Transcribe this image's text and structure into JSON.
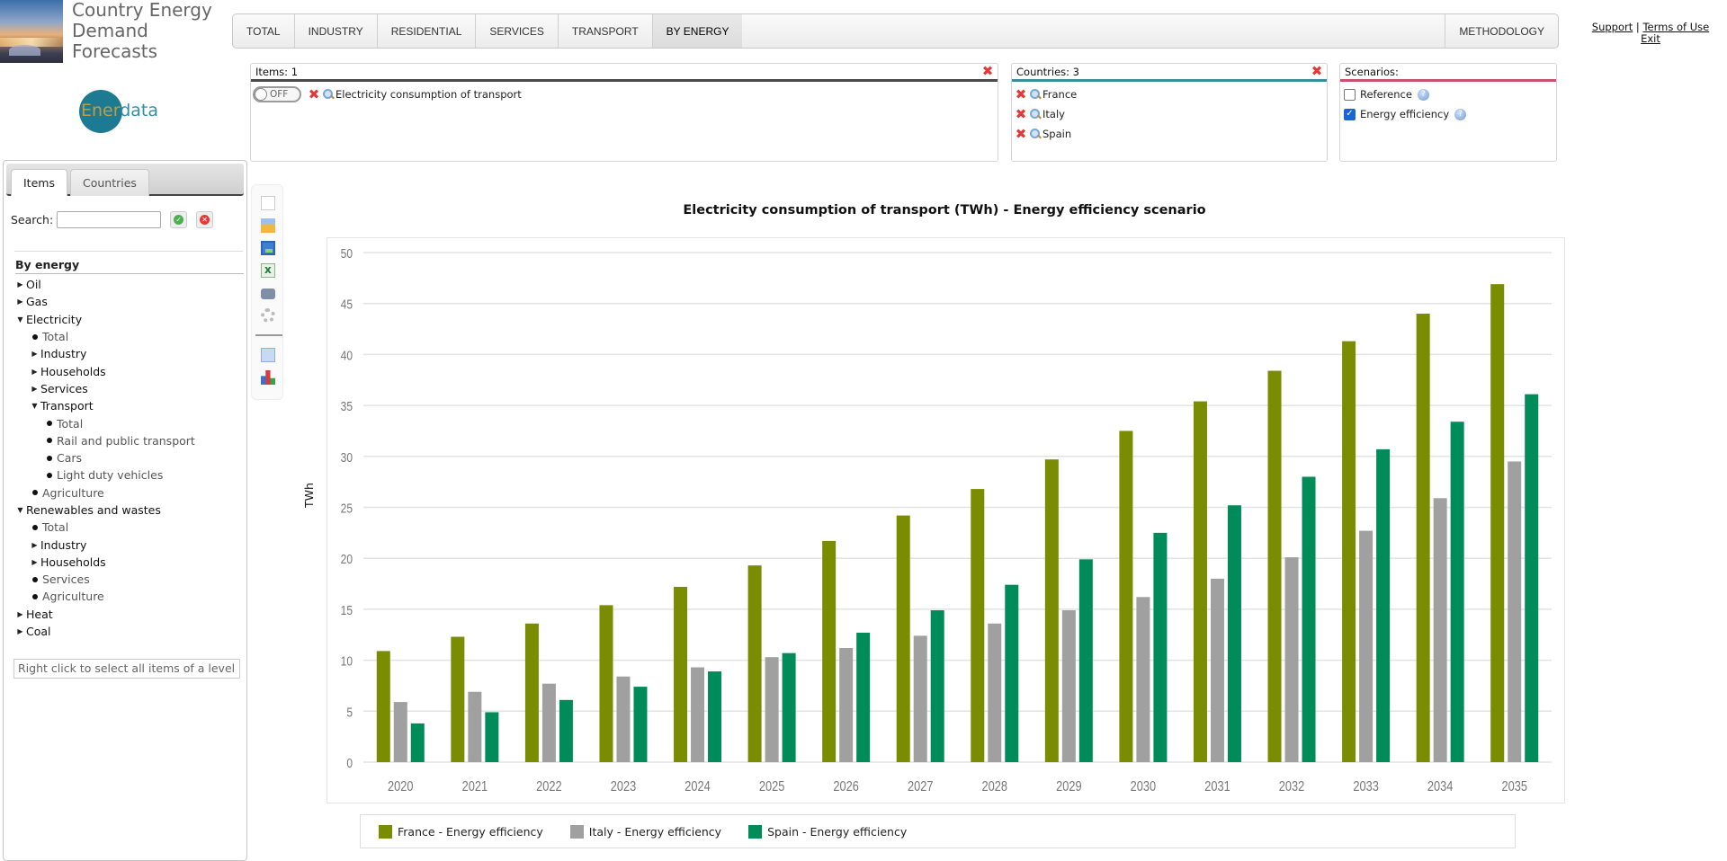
{
  "app": {
    "title": "Country Energy Demand Forecasts",
    "logo_text_a": "Ener",
    "logo_text_b": "data"
  },
  "nav": {
    "tabs": [
      {
        "label": "TOTAL",
        "active": false
      },
      {
        "label": "INDUSTRY",
        "active": false
      },
      {
        "label": "RESIDENTIAL",
        "active": false
      },
      {
        "label": "SERVICES",
        "active": false
      },
      {
        "label": "TRANSPORT",
        "active": false
      },
      {
        "label": "BY ENERGY",
        "active": true
      }
    ],
    "methodology": "METHODOLOGY"
  },
  "links": {
    "support": "Support",
    "separator": "|",
    "terms": "Terms of Use",
    "exit": "Exit"
  },
  "items_panel": {
    "header": "Items: 1",
    "toggle_label": "OFF",
    "items": [
      "Electricity consumption of transport"
    ]
  },
  "countries_panel": {
    "header": "Countries: 3",
    "countries": [
      "France",
      "Italy",
      "Spain"
    ]
  },
  "scenarios_panel": {
    "header": "Scenarios:",
    "scenarios": [
      {
        "label": "Reference",
        "checked": false
      },
      {
        "label": "Energy efficiency",
        "checked": true
      }
    ]
  },
  "sidebar": {
    "tabs": [
      {
        "label": "Items",
        "active": true
      },
      {
        "label": "Countries",
        "active": false
      }
    ],
    "search_label": "Search:",
    "search_value": "",
    "tree_header": "By energy",
    "tree": [
      {
        "label": "Oil",
        "level": 1,
        "type": "collapsed"
      },
      {
        "label": "Gas",
        "level": 1,
        "type": "collapsed"
      },
      {
        "label": "Electricity",
        "level": 1,
        "type": "expanded"
      },
      {
        "label": "Total",
        "level": 2,
        "type": "leaf"
      },
      {
        "label": "Industry",
        "level": 2,
        "type": "collapsed"
      },
      {
        "label": "Households",
        "level": 2,
        "type": "collapsed"
      },
      {
        "label": "Services",
        "level": 2,
        "type": "collapsed"
      },
      {
        "label": "Transport",
        "level": 2,
        "type": "expanded"
      },
      {
        "label": "Total",
        "level": 3,
        "type": "leaf"
      },
      {
        "label": "Rail and public transport",
        "level": 3,
        "type": "leaf"
      },
      {
        "label": "Cars",
        "level": 3,
        "type": "leaf"
      },
      {
        "label": "Light duty vehicles",
        "level": 3,
        "type": "leaf"
      },
      {
        "label": "Agriculture",
        "level": 2,
        "type": "leaf"
      },
      {
        "label": "Renewables and wastes",
        "level": 1,
        "type": "expanded"
      },
      {
        "label": "Total",
        "level": 2,
        "type": "leaf"
      },
      {
        "label": "Industry",
        "level": 2,
        "type": "collapsed"
      },
      {
        "label": "Households",
        "level": 2,
        "type": "collapsed"
      },
      {
        "label": "Services",
        "level": 2,
        "type": "leaf"
      },
      {
        "label": "Agriculture",
        "level": 2,
        "type": "leaf"
      },
      {
        "label": "Heat",
        "level": 1,
        "type": "collapsed"
      },
      {
        "label": "Coal",
        "level": 1,
        "type": "collapsed"
      }
    ],
    "hint": "Right click to select all items of a level"
  },
  "toolbar": {
    "icons": [
      "new-document-icon",
      "open-folder-icon",
      "save-icon",
      "excel-export-icon",
      "print-icon",
      "settings-gear-icon",
      "table-view-icon",
      "chart-view-icon"
    ]
  },
  "chart_data": {
    "type": "bar",
    "title": "Electricity consumption of transport (TWh) - Energy efficiency scenario",
    "xlabel": "",
    "ylabel": "TWh",
    "ylim": [
      0,
      50
    ],
    "yticks": [
      0,
      5,
      10,
      15,
      20,
      25,
      30,
      35,
      40,
      45,
      50
    ],
    "grid": true,
    "legend_position": "bottom",
    "categories": [
      "2020",
      "2021",
      "2022",
      "2023",
      "2024",
      "2025",
      "2026",
      "2027",
      "2028",
      "2029",
      "2030",
      "2031",
      "2032",
      "2033",
      "2034",
      "2035"
    ],
    "series": [
      {
        "name": "France - Energy efficiency",
        "color": "#7a8c00",
        "values": [
          10.9,
          12.3,
          13.6,
          15.4,
          17.2,
          19.3,
          21.7,
          24.2,
          26.8,
          29.7,
          32.5,
          35.4,
          38.4,
          41.3,
          44.0,
          46.9
        ]
      },
      {
        "name": "Italy - Energy efficiency",
        "color": "#a0a0a0",
        "values": [
          5.9,
          6.9,
          7.7,
          8.4,
          9.3,
          10.3,
          11.2,
          12.4,
          13.6,
          14.9,
          16.2,
          18.0,
          20.1,
          22.7,
          25.9,
          29.5
        ]
      },
      {
        "name": "Spain - Energy efficiency",
        "color": "#008c5a",
        "values": [
          3.8,
          4.9,
          6.1,
          7.4,
          8.9,
          10.7,
          12.7,
          14.9,
          17.4,
          19.9,
          22.5,
          25.2,
          28.0,
          30.7,
          33.4,
          36.1
        ]
      }
    ]
  }
}
